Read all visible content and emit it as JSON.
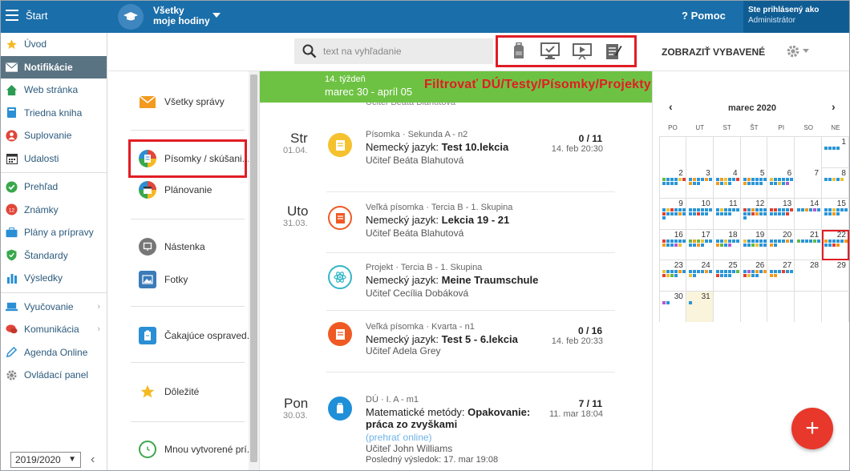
{
  "topbar": {
    "start_label": "Štart",
    "hours_line1": "Všetky",
    "hours_line2": "moje hodiny",
    "help_label": "Pomoc",
    "user_line1": "Ste prihlásený ako",
    "user_line2": "Administrátor"
  },
  "nav": {
    "items": [
      {
        "label": "Úvod",
        "icon": "star-icon"
      },
      {
        "label": "Notifikácie",
        "icon": "envelope-icon"
      },
      {
        "label": "Web stránka",
        "icon": "home-icon"
      },
      {
        "label": "Triedna kniha",
        "icon": "book-icon"
      },
      {
        "label": "Suplovanie",
        "icon": "person-icon"
      },
      {
        "label": "Udalosti",
        "icon": "calendar-icon"
      },
      {
        "label": "Prehľad",
        "icon": "check-circle-icon"
      },
      {
        "label": "Známky",
        "icon": "grades-icon"
      },
      {
        "label": "Plány a prípravy",
        "icon": "briefcase-icon"
      },
      {
        "label": "Štandardy",
        "icon": "shield-icon"
      },
      {
        "label": "Výsledky",
        "icon": "bar-chart-icon"
      },
      {
        "label": "Vyučovanie",
        "icon": "laptop-icon"
      },
      {
        "label": "Komunikácia",
        "icon": "chat-icon"
      },
      {
        "label": "Agenda Online",
        "icon": "pen-icon"
      },
      {
        "label": "Ovládací panel",
        "icon": "gear-icon"
      }
    ],
    "year": "2019/2020"
  },
  "toolbar": {
    "search_placeholder": "text na vyhľadanie",
    "show_equipped": "ZOBRAZIŤ VYBAVENÉ"
  },
  "messages": {
    "all": "Všetky správy",
    "tests": "Písomky / skúšani...",
    "planning": "Plánovanie",
    "board": "Nástenka",
    "photos": "Fotky",
    "excuses": "Čakajúce ospraved...",
    "important": "Dôležité",
    "created": "Mnou vytvorené prí..."
  },
  "week": {
    "label": "14. týždeň",
    "range": "marec 30 - apríl 05",
    "filter_note": "Filtrovať DÚ/Testy/Písomky/Projekty"
  },
  "days": [
    {
      "name": "Str",
      "date": "01.04.",
      "items": [
        {
          "meta": "Písomka · Sekunda A - n2",
          "subject": "Nemecký jazyk:",
          "title": "Test 10.lekcia",
          "teacher": "Učiteľ Beáta Blahutová",
          "score": "0 / 11",
          "date": "14. feb 20:30"
        }
      ]
    },
    {
      "name": "Uto",
      "date": "31.03.",
      "items": [
        {
          "meta": "Veľká písomka · Tercia B - 1. Skupina",
          "subject": "Nemecký jazyk:",
          "title": "Lekcia 19 - 21",
          "teacher": "Učiteľ Beáta Blahutová",
          "score": "",
          "date": ""
        },
        {
          "meta": "Projekt · Tercia B - 1. Skupina",
          "subject": "Nemecký jazyk:",
          "title": "Meine Traumschule",
          "teacher": "Učiteľ Cecília Dobáková",
          "score": "",
          "date": ""
        },
        {
          "meta": "Veľká písomka · Kvarta - n1",
          "subject": "Nemecký jazyk:",
          "title": "Test 5 - 6.lekcia",
          "teacher": "Učiteľ Adela Grey",
          "score": "0 / 16",
          "date": "14. feb 20:33"
        }
      ]
    },
    {
      "name": "Pon",
      "date": "30.03.",
      "items": [
        {
          "meta": "DÚ · I. A - m1",
          "subject": "Matematické metódy:",
          "title": "Opakovanie:",
          "title2": "práca zo zvyškami",
          "link": "(prehrať online)",
          "teacher": "Učiteľ John Williams",
          "last_result": "Posledný výsledok: 17. mar 19:08",
          "score": "7 / 11",
          "date": "11. mar 18:04"
        }
      ]
    }
  ],
  "calendar": {
    "month": "marec 2020",
    "weekdays": [
      "PO",
      "UT",
      "ST",
      "ŠT",
      "PI",
      "SO",
      "NE"
    ],
    "weeks": [
      [
        null,
        null,
        null,
        null,
        null,
        null,
        "1"
      ],
      [
        "2",
        "3",
        "4",
        "5",
        "6",
        "7",
        "8"
      ],
      [
        "9",
        "10",
        "11",
        "12",
        "13",
        "14",
        "15"
      ],
      [
        "16",
        "17",
        "18",
        "19",
        "20",
        "21",
        "22"
      ],
      [
        "23",
        "24",
        "25",
        "26",
        "27",
        "28",
        "29"
      ],
      [
        "30",
        "31",
        null,
        null,
        null,
        null,
        null
      ]
    ]
  },
  "fab_label": "+"
}
